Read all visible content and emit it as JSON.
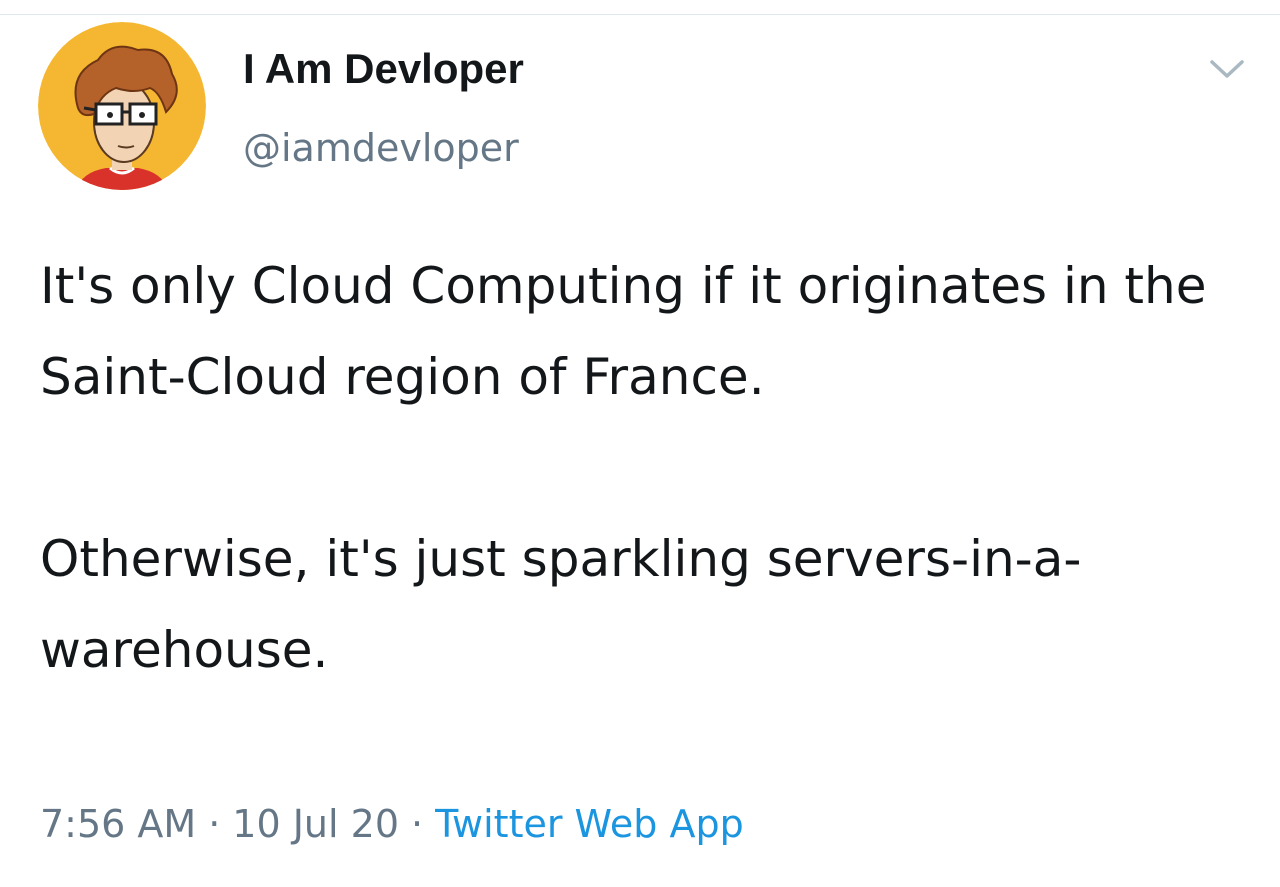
{
  "tweet": {
    "display_name": "I Am Devloper",
    "handle": "@iamdevloper",
    "text_paragraph_1": "It's only Cloud Computing if it originates in the Saint-Cloud region of France.",
    "text_paragraph_2": "Otherwise, it's just sparkling servers-in-a-warehouse.",
    "time": "7:56 AM",
    "date": "10 Jul 20",
    "source": "Twitter Web App",
    "separator": "·"
  },
  "icons": {
    "avatar": "cartoon-developer-avatar",
    "menu": "chevron-down-icon"
  },
  "colors": {
    "text_primary": "#14171a",
    "text_secondary": "#657786",
    "link": "#1b95e0",
    "avatar_background": "#f5b731",
    "divider": "#e1e8ed"
  }
}
